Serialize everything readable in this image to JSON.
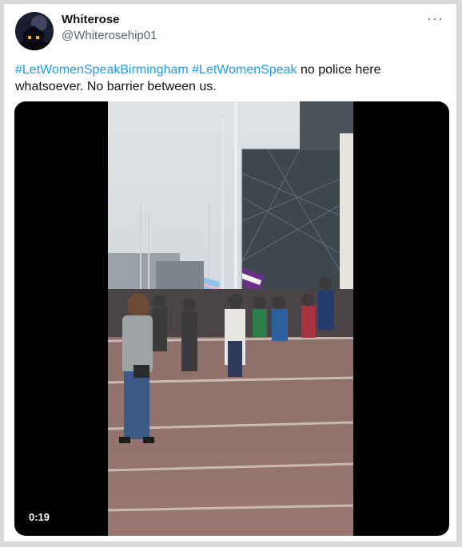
{
  "author": {
    "display_name": "Whiterose",
    "handle": "@Whiterosehip01"
  },
  "tweet": {
    "hashtag_1": "#LetWomenSpeakBirmingham",
    "hashtag_2": "#LetWomenSpeak",
    "body_text": " no police here whatsoever. No barrier between us."
  },
  "video": {
    "duration": "0:19"
  },
  "menu": {
    "more_label": "···"
  },
  "colors": {
    "link": "#1d9bf0",
    "text": "#0f1419",
    "secondary": "#536471"
  }
}
